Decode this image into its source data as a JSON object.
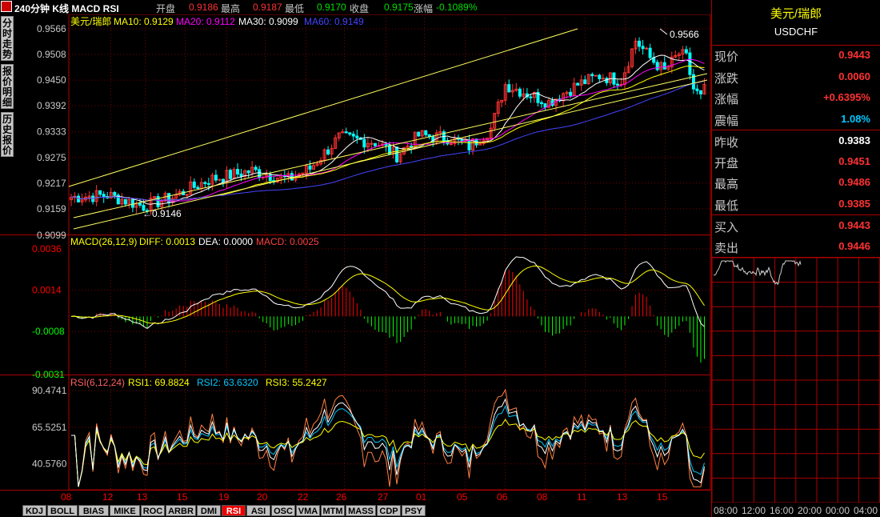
{
  "header": {
    "title": "240分钟 K线 MACD RSI",
    "open_label": "开盘",
    "open": "0.9186",
    "high_label": "最高",
    "high": "0.9187",
    "low_label": "最低",
    "low": "0.9170",
    "close_label": "收盘",
    "close": "0.9175",
    "change_label": "涨幅",
    "change": "-0.1089%"
  },
  "side_tabs": [
    "分时走势",
    "报价明细",
    "历史报价"
  ],
  "colors": {
    "up": "#ff3232",
    "down": "#00e000",
    "grid": "#7a0000",
    "axis_text": "#c8c8c8",
    "ma10": "#ffffff",
    "ma20": "#ff00ff",
    "ma30": "#ffff00",
    "ma60": "#4444ff",
    "diff": "#ffffff",
    "dea": "#ffff00",
    "rsi1": "#ffffff",
    "rsi2": "#00c8ff",
    "rsi3": "#ffff00",
    "rsi_orange": "#ff8040",
    "panel_green": "#00ff00",
    "panel_red": "#ff0000"
  },
  "chart_data": [
    {
      "type": "candlestick",
      "title": "美元/瑞郎",
      "legend": [
        {
          "name": "MA10",
          "value": "0.9129"
        },
        {
          "name": "MA20",
          "value": "0.9112"
        },
        {
          "name": "MA30",
          "value": "0.9099"
        },
        {
          "name": "MA60",
          "value": "0.9149"
        }
      ],
      "y_ticks": [
        "0.9566",
        "0.9508",
        "0.9450",
        "0.9392",
        "0.9333",
        "0.9275",
        "0.9217",
        "0.9159",
        "0.9099"
      ],
      "ylim": [
        0.9099,
        0.9566
      ],
      "x_ticks": [
        "08",
        "12",
        "13",
        "15",
        "19",
        "20",
        "22",
        "26",
        "27",
        "01",
        "05",
        "06",
        "08",
        "11",
        "13",
        "15"
      ],
      "annotations": [
        {
          "text": "0.9566"
        },
        {
          "text": "0.9146"
        }
      ],
      "candles": []
    },
    {
      "type": "bar_line",
      "title": "MACD(26,12,9)",
      "legend": [
        {
          "name": "DIFF",
          "value": "0.0013"
        },
        {
          "name": "DEA",
          "value": "0.0000"
        },
        {
          "name": "MACD",
          "value": "0.0025"
        }
      ],
      "y_ticks": [
        "0.0036",
        "0.0014",
        "-0.0008",
        "-0.0031"
      ],
      "ylim": [
        -0.0031,
        0.0036
      ]
    },
    {
      "type": "line",
      "title": "RSI(6,12,24)",
      "legend": [
        {
          "name": "RSI1",
          "value": "69.8824"
        },
        {
          "name": "RSI2",
          "value": "63.6320"
        },
        {
          "name": "RSI3",
          "value": "55.2427"
        }
      ],
      "y_ticks": [
        "90.4741",
        "65.5251",
        "40.5760"
      ],
      "ylim": [
        24,
        96
      ]
    }
  ],
  "quote": {
    "name": "美元/瑞郎",
    "code": "USDCHF",
    "rows": [
      {
        "label": "现价",
        "value": "0.9443",
        "color": "#ff3232"
      },
      {
        "label": "涨跌",
        "value": "0.0060",
        "color": "#ff3232"
      },
      {
        "label": "涨幅",
        "value": "+0.6395%",
        "color": "#ff3232"
      },
      {
        "label": "震幅",
        "value": "1.08%",
        "color": "#00c8ff"
      },
      {
        "label": "昨收",
        "value": "0.9383",
        "color": "#ffffff"
      },
      {
        "label": "开盘",
        "value": "0.9451",
        "color": "#ff3232"
      },
      {
        "label": "最高",
        "value": "0.9486",
        "color": "#ff3232"
      },
      {
        "label": "最低",
        "value": "0.9385",
        "color": "#ff3232"
      },
      {
        "label": "买入",
        "value": "0.9443",
        "color": "#ff3232"
      },
      {
        "label": "卖出",
        "value": "0.9446",
        "color": "#ff3232"
      }
    ],
    "time_ticks": [
      "08:00",
      "12:00",
      "16:00",
      "20:00",
      "00:00",
      "04:00"
    ]
  },
  "indicator_tabs": [
    "KDJ",
    "BOLL",
    "BIAS",
    "MIKE",
    "ROC",
    "ARBR",
    "DMI",
    "RSI",
    "ASI",
    "OSC",
    "VMA",
    "MTM",
    "MASS",
    "CDP",
    "PSY"
  ],
  "active_tab": "RSI"
}
